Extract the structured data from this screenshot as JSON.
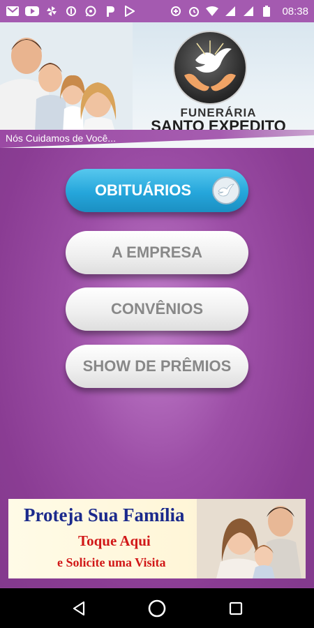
{
  "status_bar": {
    "time": "08:38",
    "left_icons": [
      "mail-icon",
      "youtube-icon",
      "pinwheel-icon",
      "sync-icon",
      "whatsapp-icon",
      "p-icon",
      "play-store-icon"
    ],
    "right_icons": [
      "data-saver-icon",
      "alarm-icon",
      "wifi-icon",
      "signal-icon",
      "signal-icon",
      "battery-icon"
    ]
  },
  "header": {
    "brand_line1": "FUNERÁRIA",
    "brand_line2": "SANTO EXPEDITO",
    "tagline": "Nós Cuidamos de Você..."
  },
  "menu": {
    "obituarios": "OBITUÁRIOS",
    "empresa": "A EMPRESA",
    "convenios": "CONVÊNIOS",
    "premios": "SHOW DE PRÊMIOS"
  },
  "ad": {
    "title": "Proteja Sua Família",
    "cta": "Toque Aqui",
    "sub": "e Solicite uma Visita"
  },
  "colors": {
    "primary_purple": "#8e3f96",
    "obituarios_blue": "#25a6db",
    "ad_title_blue": "#1b2a8c",
    "ad_red": "#d11818"
  }
}
